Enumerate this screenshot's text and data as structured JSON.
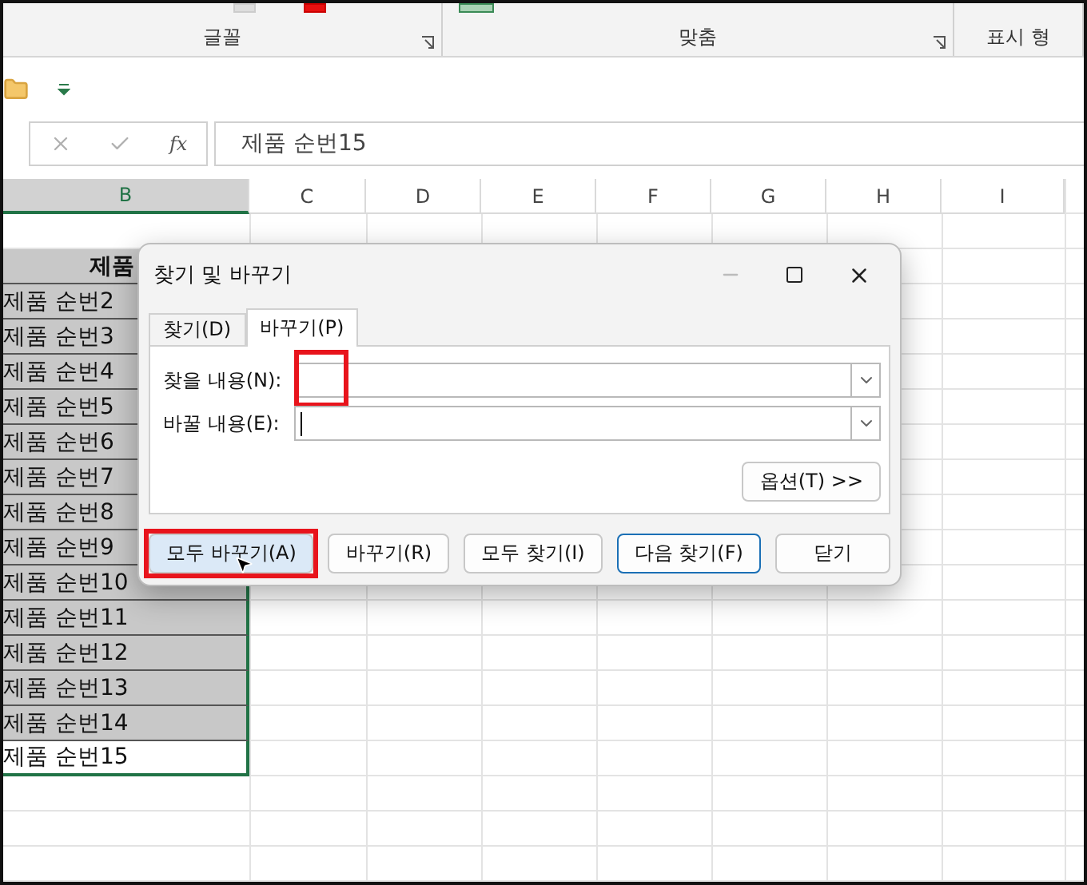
{
  "ribbon": {
    "groups": [
      {
        "label": "글꼴",
        "launcher": true
      },
      {
        "label": "맞춤",
        "launcher": true
      },
      {
        "label": "표시 형",
        "launcher": false
      }
    ]
  },
  "formula_bar": {
    "function_label": "fx",
    "value": "제품 순번15"
  },
  "columns": [
    {
      "label": "B",
      "selected": true
    },
    {
      "label": "C",
      "selected": false
    },
    {
      "label": "D",
      "selected": false
    },
    {
      "label": "E",
      "selected": false
    },
    {
      "label": "F",
      "selected": false
    },
    {
      "label": "G",
      "selected": false
    },
    {
      "label": "H",
      "selected": false
    },
    {
      "label": "I",
      "selected": false
    }
  ],
  "cells": [
    {
      "text": "제품",
      "kind": "header",
      "selected": true
    },
    {
      "text": "제품 순번2",
      "kind": "data",
      "selected": true
    },
    {
      "text": "제품 순번3",
      "kind": "data",
      "selected": true
    },
    {
      "text": "제품 순번4",
      "kind": "data",
      "selected": true
    },
    {
      "text": "제품 순번5",
      "kind": "data",
      "selected": true
    },
    {
      "text": "제품 순번6",
      "kind": "data",
      "selected": true
    },
    {
      "text": "제품 순번7",
      "kind": "data",
      "selected": true
    },
    {
      "text": "제품 순번8",
      "kind": "data",
      "selected": true
    },
    {
      "text": "제품 순번9",
      "kind": "data",
      "selected": true
    },
    {
      "text": "제품 순번10",
      "kind": "data",
      "selected": true
    },
    {
      "text": "제품 순번11",
      "kind": "data",
      "selected": true
    },
    {
      "text": "제품 순번12",
      "kind": "data",
      "selected": true
    },
    {
      "text": "제품 순번13",
      "kind": "data",
      "selected": true
    },
    {
      "text": "제품 순번14",
      "kind": "data",
      "selected": true
    },
    {
      "text": "제품 순번15",
      "kind": "data",
      "selected": false
    }
  ],
  "dialog": {
    "title": "찾기 및 바꾸기",
    "tabs": [
      {
        "label": "찾기(D)",
        "selected": false
      },
      {
        "label": "바꾸기(P)",
        "selected": true
      }
    ],
    "fields": [
      {
        "label": "찾을 내용(N):",
        "focused": false,
        "highlighted": true
      },
      {
        "label": "바꿀 내용(E):",
        "focused": true,
        "highlighted": false
      }
    ],
    "options_button": "옵션(T) >>",
    "buttons": [
      {
        "label": "모두 바꾸기(A)",
        "default": false,
        "hovered": true,
        "highlighted": true
      },
      {
        "label": "바꾸기(R)",
        "default": false,
        "hovered": false,
        "highlighted": false
      },
      {
        "label": "모두 찾기(I)",
        "default": false,
        "hovered": false,
        "highlighted": false
      },
      {
        "label": "다음 찾기(F)",
        "default": true,
        "hovered": false,
        "highlighted": false
      },
      {
        "label": "닫기",
        "default": false,
        "hovered": false,
        "highlighted": false
      }
    ]
  }
}
